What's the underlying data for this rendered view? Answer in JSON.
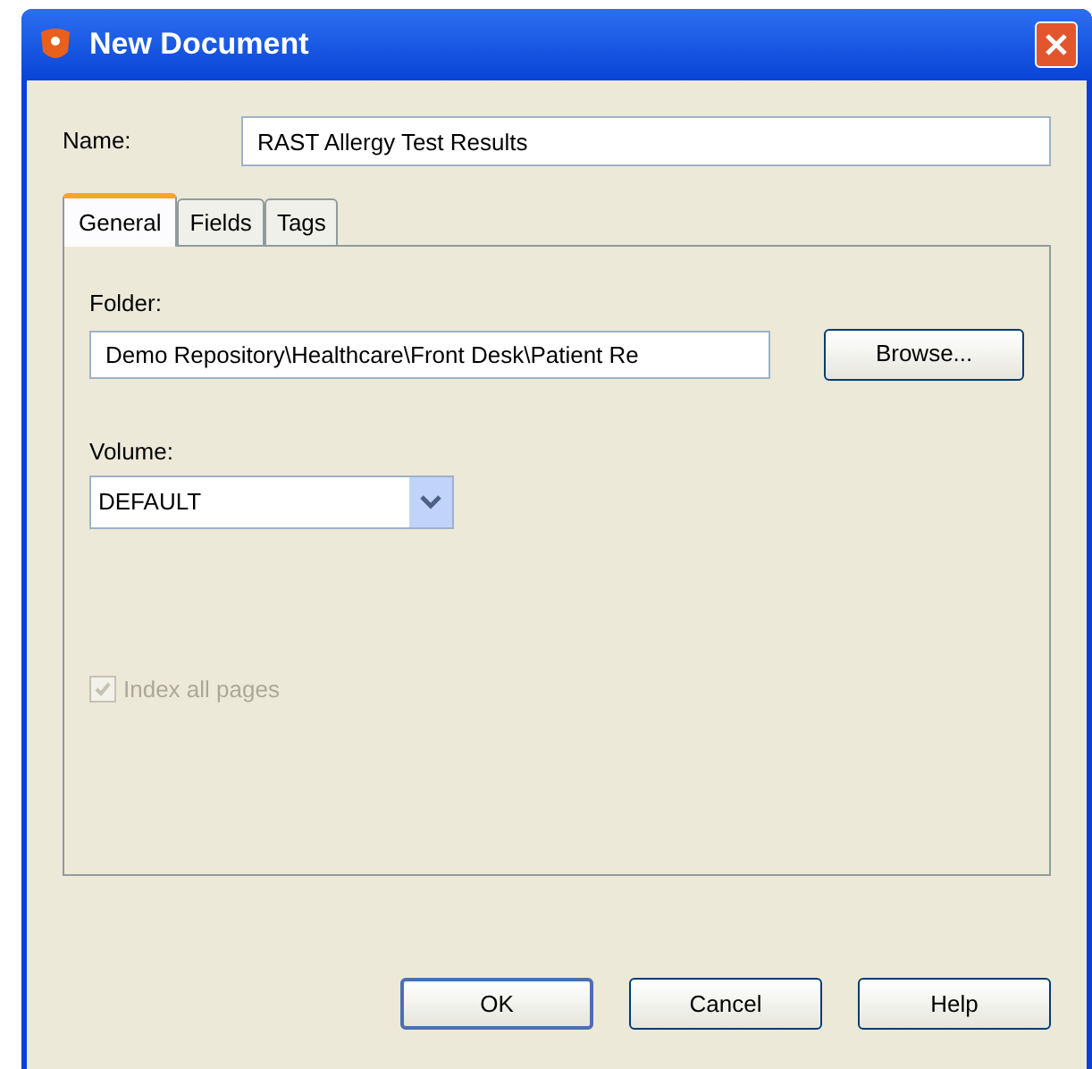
{
  "window": {
    "title": "New Document"
  },
  "name_field": {
    "label": "Name:",
    "value": "RAST Allergy Test Results"
  },
  "tabs": [
    {
      "label": "General",
      "selected": true
    },
    {
      "label": "Fields",
      "selected": false
    },
    {
      "label": "Tags",
      "selected": false
    }
  ],
  "folder": {
    "label": "Folder:",
    "value": "Demo Repository\\Healthcare\\Front Desk\\Patient Re",
    "button": "Browse..."
  },
  "volume": {
    "label": "Volume:",
    "value": "DEFAULT"
  },
  "index_all_pages": {
    "label": "Index all pages",
    "checked": true,
    "disabled": true
  },
  "buttons": [
    {
      "label": "OK",
      "default": true
    },
    {
      "label": "Cancel",
      "default": false
    },
    {
      "label": "Help",
      "default": false
    }
  ]
}
